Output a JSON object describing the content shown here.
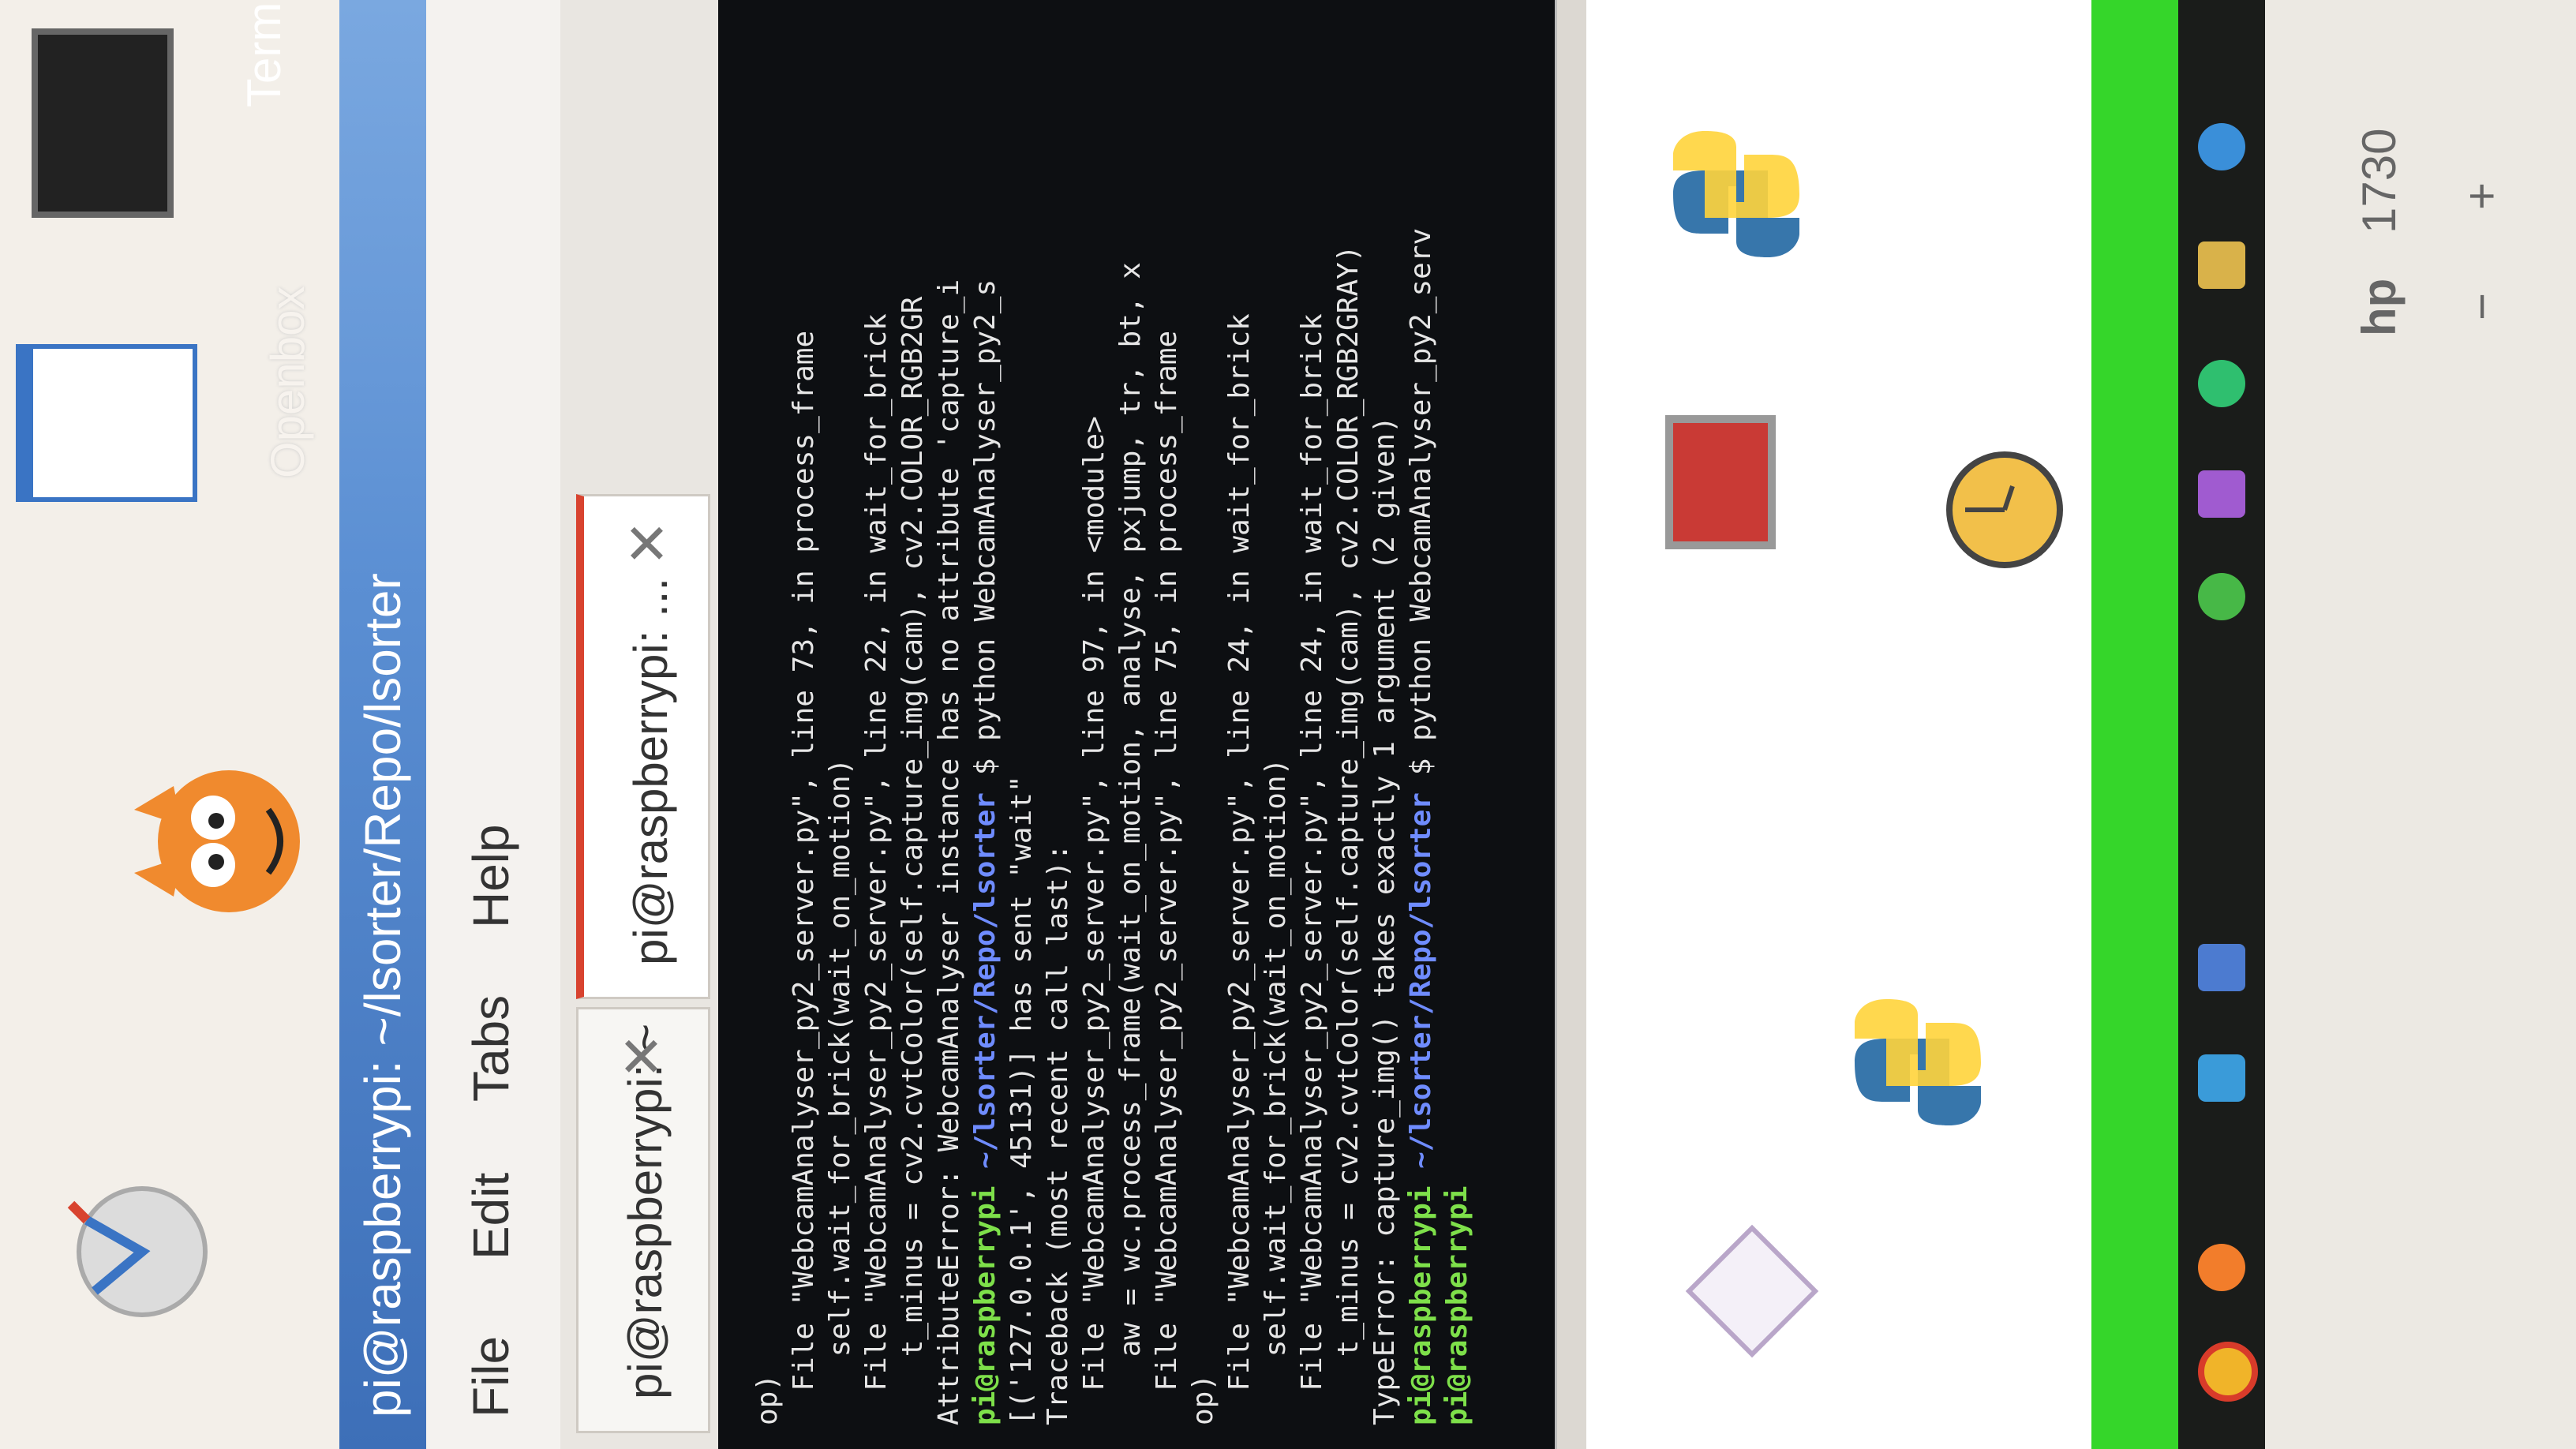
{
  "window": {
    "title": "pi@raspberrypi: ~/lsorter/Repo/lsorter",
    "menu": [
      "File",
      "Edit",
      "Tabs",
      "Help"
    ],
    "tabs": [
      {
        "label": "pi@raspberrypi: ~",
        "active": false
      },
      {
        "label": "pi@raspberrypi: ...",
        "active": true
      }
    ],
    "close_glyph": "✕"
  },
  "desktop": {
    "openbox_label": "Openbox",
    "term_label": "Term"
  },
  "terminal": {
    "lines": [
      {
        "kind": "text",
        "text": "op)"
      },
      {
        "kind": "text",
        "text": "  File \"WebcamAnalyser_py2_server.py\", line 73, in process_frame"
      },
      {
        "kind": "text",
        "text": "    self.wait_for_brick(wait_on_motion)"
      },
      {
        "kind": "text",
        "text": "  File \"WebcamAnalyser_py2_server.py\", line 22, in wait_for_brick"
      },
      {
        "kind": "text",
        "text": "    t_minus = cv2.cvtColor(self.capture_img(cam), cv2.COLOR_RGB2GR"
      },
      {
        "kind": "text",
        "text": "AttributeError: WebcamAnalyser instance has no attribute 'capture_i"
      },
      {
        "kind": "prompt",
        "user": "pi@raspberrypi",
        "path": "~/lsorter/Repo/lsorter",
        "cmd": " $ python WebcamAnalyser_py2_s"
      },
      {
        "kind": "text",
        "text": "[('127.0.0.1', 45131)] has sent \"wait\""
      },
      {
        "kind": "text",
        "text": "Traceback (most recent call last):"
      },
      {
        "kind": "text",
        "text": "  File \"WebcamAnalyser_py2_server.py\", line 97, in <module>"
      },
      {
        "kind": "text",
        "text": "    aw = wc.process_frame(wait_on_motion, analyse, pxjump, tr, bt, x"
      },
      {
        "kind": "text",
        "text": "  File \"WebcamAnalyser_py2_server.py\", line 75, in process_frame"
      },
      {
        "kind": "text",
        "text": "op)"
      },
      {
        "kind": "text",
        "text": "  File \"WebcamAnalyser_py2_server.py\", line 24, in wait_for_brick"
      },
      {
        "kind": "text",
        "text": "    self.wait_for_brick(wait_on_motion)"
      },
      {
        "kind": "text",
        "text": "  File \"WebcamAnalyser_py2_server.py\", line 24, in wait_for_brick"
      },
      {
        "kind": "text",
        "text": "    t_minus = cv2.cvtColor(self.capture_img(cam), cv2.COLOR_RGB2GRAY)"
      },
      {
        "kind": "text",
        "text": "TypeError: capture_img() takes exactly 1 argument (2 given)"
      },
      {
        "kind": "prompt",
        "user": "pi@raspberrypi",
        "path": "~/lsorter/Repo/lsorter",
        "cmd": " $ python WebcamAnalyser_py2_serv"
      },
      {
        "kind": "prompt",
        "user": "pi@raspberrypi",
        "path": "",
        "cmd": ""
      }
    ]
  },
  "monitor": {
    "brand": "hp",
    "model": "1730",
    "button_minus": "−",
    "button_plus": "+"
  },
  "colors": {
    "title_bar": "#4a7fc8",
    "terminal_bg": "#0d0f12",
    "prompt_user": "#7ee04a",
    "prompt_path": "#6f8cff",
    "active_tab_accent": "#d8432f",
    "green_bar": "#35d62a"
  }
}
